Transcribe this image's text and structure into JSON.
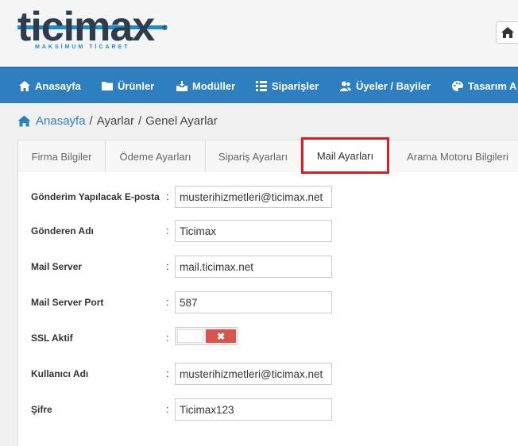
{
  "brand": {
    "name": "ticimax",
    "tagline": "MAKSİMUM TİCARET",
    "registered": "®"
  },
  "nav": {
    "items": [
      {
        "label": "Anasayfa",
        "icon": "home-icon"
      },
      {
        "label": "Ürünler",
        "icon": "folder-icon"
      },
      {
        "label": "Modüller",
        "icon": "download-box-icon"
      },
      {
        "label": "Siparişler",
        "icon": "list-icon"
      },
      {
        "label": "Üyeler / Bayiler",
        "icon": "users-icon"
      },
      {
        "label": "Tasarım A",
        "icon": "palette-icon"
      }
    ]
  },
  "breadcrumb": {
    "home": "Anasayfa",
    "sep": "/",
    "level1": "Ayarlar",
    "level2": "Genel Ayarlar"
  },
  "tabs": [
    {
      "label": "Firma Bilgiler",
      "active": false
    },
    {
      "label": "Ödeme Ayarları",
      "active": false
    },
    {
      "label": "Sipariş Ayarları",
      "active": false
    },
    {
      "label": "Mail Ayarları",
      "active": true
    },
    {
      "label": "Arama Motoru Bilgileri",
      "active": false
    }
  ],
  "form": {
    "colon": ":",
    "sender_email": {
      "label": "Gönderim Yapılacak E-posta",
      "value": "musterihizmetleri@ticimax.net"
    },
    "sender_name": {
      "label": "Gönderen Adı",
      "value": "Ticimax"
    },
    "mail_server": {
      "label": "Mail Server",
      "value": "mail.ticimax.net"
    },
    "mail_server_port": {
      "label": "Mail Server Port",
      "value": "587"
    },
    "ssl_active": {
      "label": "SSL Aktif",
      "state": "off",
      "off_glyph": "✖"
    },
    "username": {
      "label": "Kullanıcı Adı",
      "value": "musterihizmetleri@ticimax.net"
    },
    "password": {
      "label": "Şifre",
      "value": "Ticimax123"
    }
  },
  "colors": {
    "nav": "#2e7fc0",
    "highlight": "#e01b24",
    "toggle_off": "#d9534f"
  }
}
